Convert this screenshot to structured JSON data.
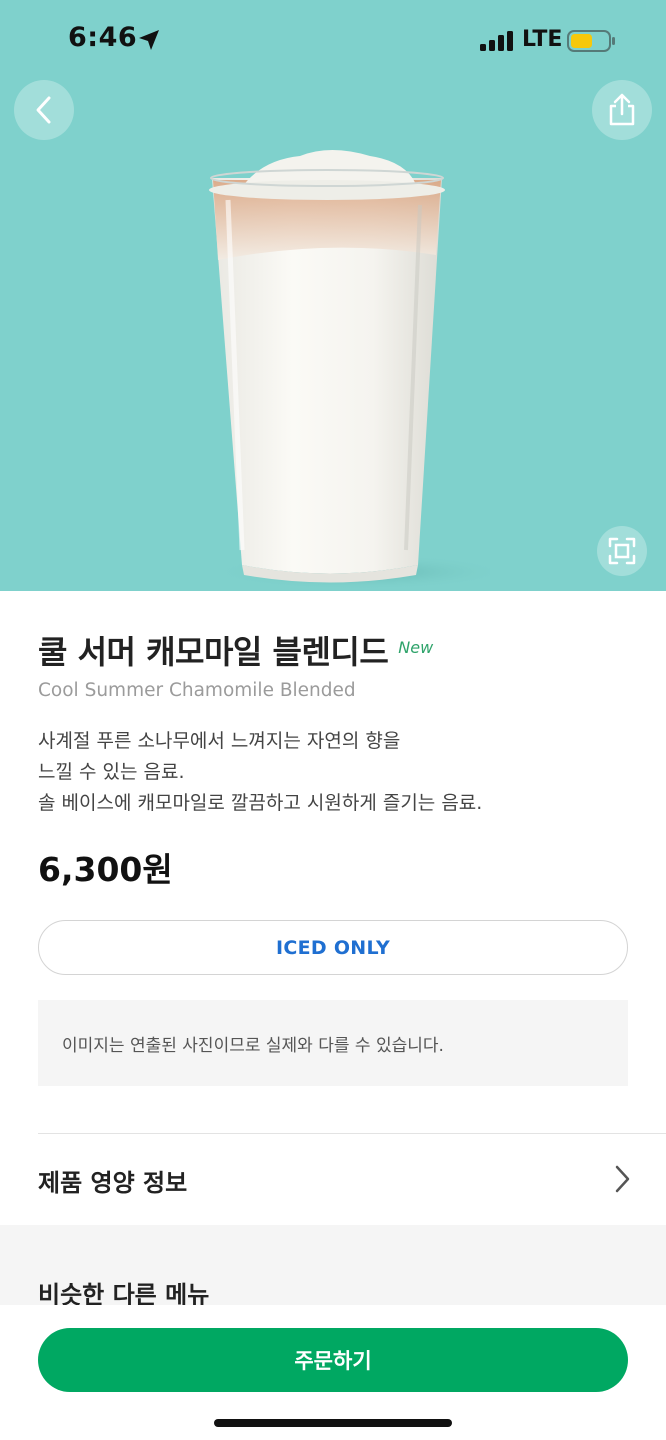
{
  "status_bar": {
    "time": "6:46",
    "network": "LTE",
    "battery_level_percent": 50
  },
  "hero": {
    "background_color": "#7fd1cc",
    "icons": [
      "back-icon",
      "share-icon",
      "expand-icon"
    ]
  },
  "product": {
    "name_ko": "쿨 서머 캐모마일 블렌디드",
    "badge": "New",
    "name_en": "Cool Summer Chamomile Blended",
    "description_lines": [
      "사계절 푸른 소나무에서 느껴지는 자연의 향을",
      "느낄 수 있는 음료.",
      "솔 베이스에 캐모마일로 깔끔하고 시원하게 즐기는 음료."
    ],
    "price": "6,300원",
    "temperature_option": "ICED ONLY",
    "notice": "이미지는 연출된 사진이므로 실제와 다를 수 있습니다."
  },
  "nutrition": {
    "label": "제품 영양 정보"
  },
  "similar": {
    "title": "비슷한 다른 메뉴"
  },
  "bottom": {
    "order_label": "주문하기",
    "accent_color": "#00a862"
  }
}
